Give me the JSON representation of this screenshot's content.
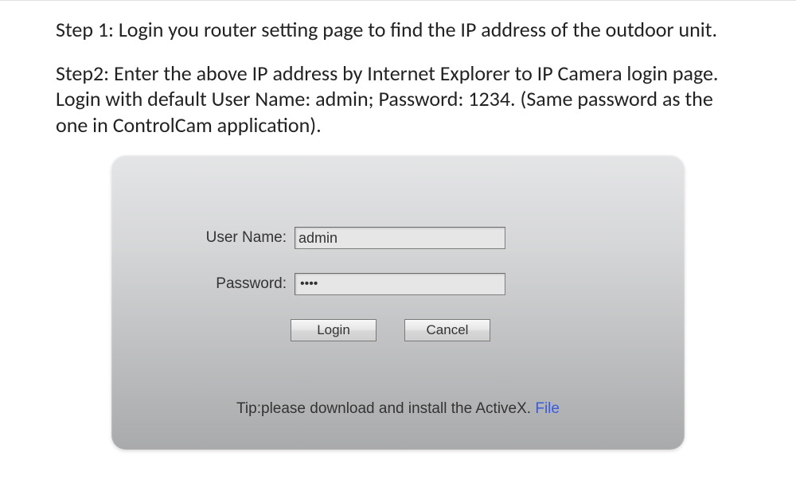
{
  "step1": "Step 1: Login you router setting page to find the IP address of the outdoor unit.",
  "step2": "Step2: Enter the above IP address by Internet Explorer to IP Camera login page. Login with default User Name: admin; Password: 1234. (Same password as the one in ControlCam application).",
  "form": {
    "username_label": "User Name:",
    "username_value": "admin",
    "password_label": "Password:",
    "password_masked": "••••",
    "login_button": "Login",
    "cancel_button": "Cancel",
    "tip_text": "Tip:please download and install the ActiveX. ",
    "file_link": "File"
  }
}
